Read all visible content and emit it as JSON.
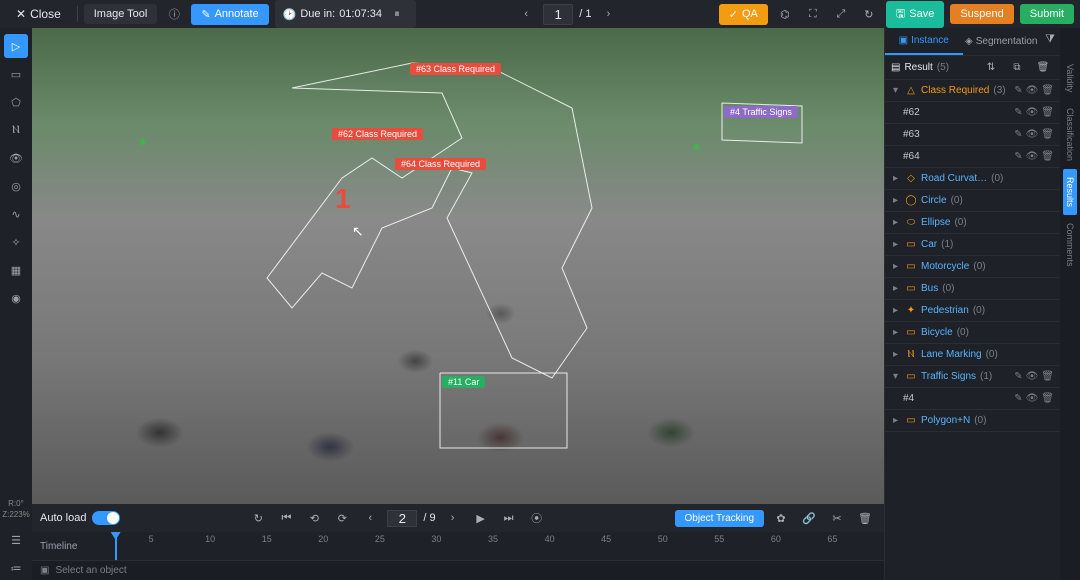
{
  "topbar": {
    "close": "Close",
    "tool": "Image Tool",
    "annotate": "Annotate",
    "due_prefix": "Due in:",
    "due_time": "01:07:34",
    "page_current": "1",
    "page_total": "/ 1",
    "qa": "QA",
    "save": "Save",
    "suspend": "Suspend",
    "submit": "Submit"
  },
  "left_tools": [
    "cursor",
    "rect",
    "poly",
    "spline",
    "eye",
    "target",
    "curve",
    "magic",
    "grid",
    "gear"
  ],
  "left_status": {
    "r": "R:0°",
    "z": "Z:223%",
    "line3": ""
  },
  "annotations": {
    "a62": "#62  Class Required",
    "a63": "#63  Class Required",
    "a64": "#64  Class Required",
    "a4": "#4  Traffic Signs",
    "a11": "#11  Car",
    "big_number": "1"
  },
  "bottombar": {
    "autoload": "Auto load",
    "frame_current": "2",
    "frame_total": "/ 9",
    "tracking": "Object Tracking"
  },
  "timeline": {
    "label": "Timeline",
    "ticks": [
      "5",
      "10",
      "15",
      "20",
      "25",
      "30",
      "35",
      "40",
      "45",
      "50",
      "55",
      "60",
      "65"
    ],
    "cursor_frame": 2
  },
  "select_row": "Select an object",
  "right": {
    "tabs": {
      "instance": "Instance",
      "segmentation": "Segmentation"
    },
    "result_label": "Result",
    "result_count": "(5)",
    "rows": [
      {
        "type": "group",
        "expanded": true,
        "icon": "△",
        "color": "orange",
        "label": "Class Required",
        "count": "(3)",
        "actions": true
      },
      {
        "type": "child",
        "label": "#62",
        "actions": true
      },
      {
        "type": "child",
        "label": "#63",
        "actions": true
      },
      {
        "type": "child",
        "label": "#64",
        "actions": true
      },
      {
        "type": "group",
        "expanded": false,
        "icon": "◇",
        "color": "blue",
        "label": "Road Curvat…",
        "count": "(0)"
      },
      {
        "type": "group",
        "expanded": false,
        "icon": "◯",
        "color": "blue",
        "label": "Circle",
        "count": "(0)"
      },
      {
        "type": "group",
        "expanded": false,
        "icon": "⬭",
        "color": "blue",
        "label": "Ellipse",
        "count": "(0)"
      },
      {
        "type": "group",
        "expanded": false,
        "icon": "▭",
        "color": "blue",
        "label": "Car",
        "count": "(1)"
      },
      {
        "type": "group",
        "expanded": false,
        "icon": "▭",
        "color": "blue",
        "label": "Motorcycle",
        "count": "(0)"
      },
      {
        "type": "group",
        "expanded": false,
        "icon": "▭",
        "color": "blue",
        "label": "Bus",
        "count": "(0)"
      },
      {
        "type": "group",
        "expanded": false,
        "icon": "✦",
        "color": "blue",
        "label": "Pedestrian",
        "count": "(0)"
      },
      {
        "type": "group",
        "expanded": false,
        "icon": "▭",
        "color": "blue",
        "label": "Bicycle",
        "count": "(0)"
      },
      {
        "type": "group",
        "expanded": false,
        "icon": "Ⲛ",
        "color": "blue",
        "label": "Lane Marking",
        "count": "(0)"
      },
      {
        "type": "group",
        "expanded": true,
        "icon": "▭",
        "color": "blue",
        "label": "Traffic Signs",
        "count": "(1)",
        "actions": true
      },
      {
        "type": "child",
        "label": "#4",
        "actions": true
      },
      {
        "type": "group",
        "expanded": false,
        "icon": "▭",
        "color": "blue",
        "label": "Polygon+N",
        "count": "(0)"
      }
    ]
  },
  "rightrail": {
    "tabs": [
      "Validity",
      "Classification",
      "Results",
      "Comments"
    ],
    "active": 2
  }
}
